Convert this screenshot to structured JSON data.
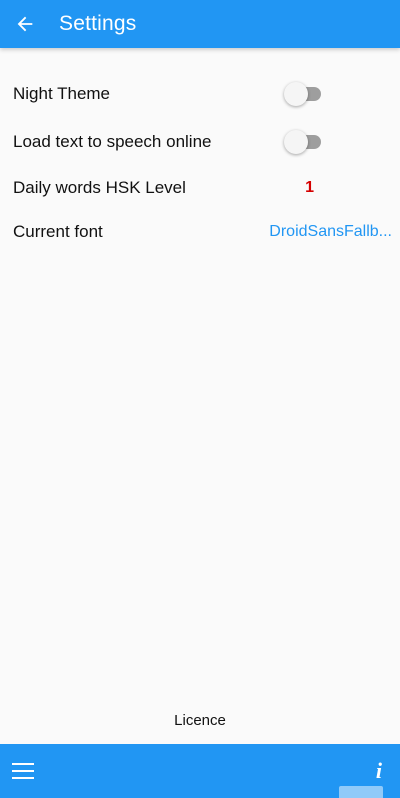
{
  "header": {
    "title": "Settings",
    "back_icon": "arrow-left-icon",
    "background_color": "#2196F3"
  },
  "settings": {
    "night_theme": {
      "label": "Night Theme",
      "enabled": false
    },
    "tts_online": {
      "label": "Load text to speech online",
      "enabled": false
    },
    "hsk_level": {
      "label": "Daily words HSK Level",
      "value": "1",
      "value_color": "#D50000"
    },
    "current_font": {
      "label": "Current font",
      "value": "DroidSansFallb...",
      "value_color": "#2196F3"
    }
  },
  "footer": {
    "licence_label": "Licence",
    "menu_icon": "hamburger-menu-icon",
    "info_icon": "info-icon",
    "info_label": "i"
  }
}
